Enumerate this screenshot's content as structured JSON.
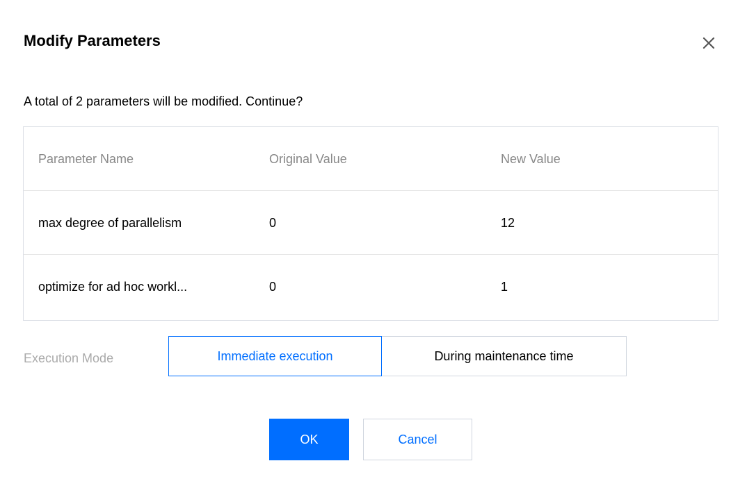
{
  "dialog": {
    "title": "Modify Parameters",
    "close_icon": "close-icon",
    "message": "A total of 2 parameters will be modified. Continue?"
  },
  "table": {
    "headers": [
      "Parameter Name",
      "Original Value",
      "New Value"
    ],
    "rows": [
      [
        "max degree of parallelism",
        "0",
        "12"
      ],
      [
        "optimize for ad hoc workl...",
        "0",
        "1"
      ]
    ]
  },
  "execution_mode": {
    "label": "Execution Mode",
    "options": [
      "Immediate execution",
      "During maintenance time"
    ],
    "selected": "Immediate execution"
  },
  "buttons": {
    "ok": "OK",
    "cancel": "Cancel"
  },
  "colors": {
    "primary": "#006eff",
    "border": "#dcdfe6",
    "muted_text": "#888888"
  }
}
